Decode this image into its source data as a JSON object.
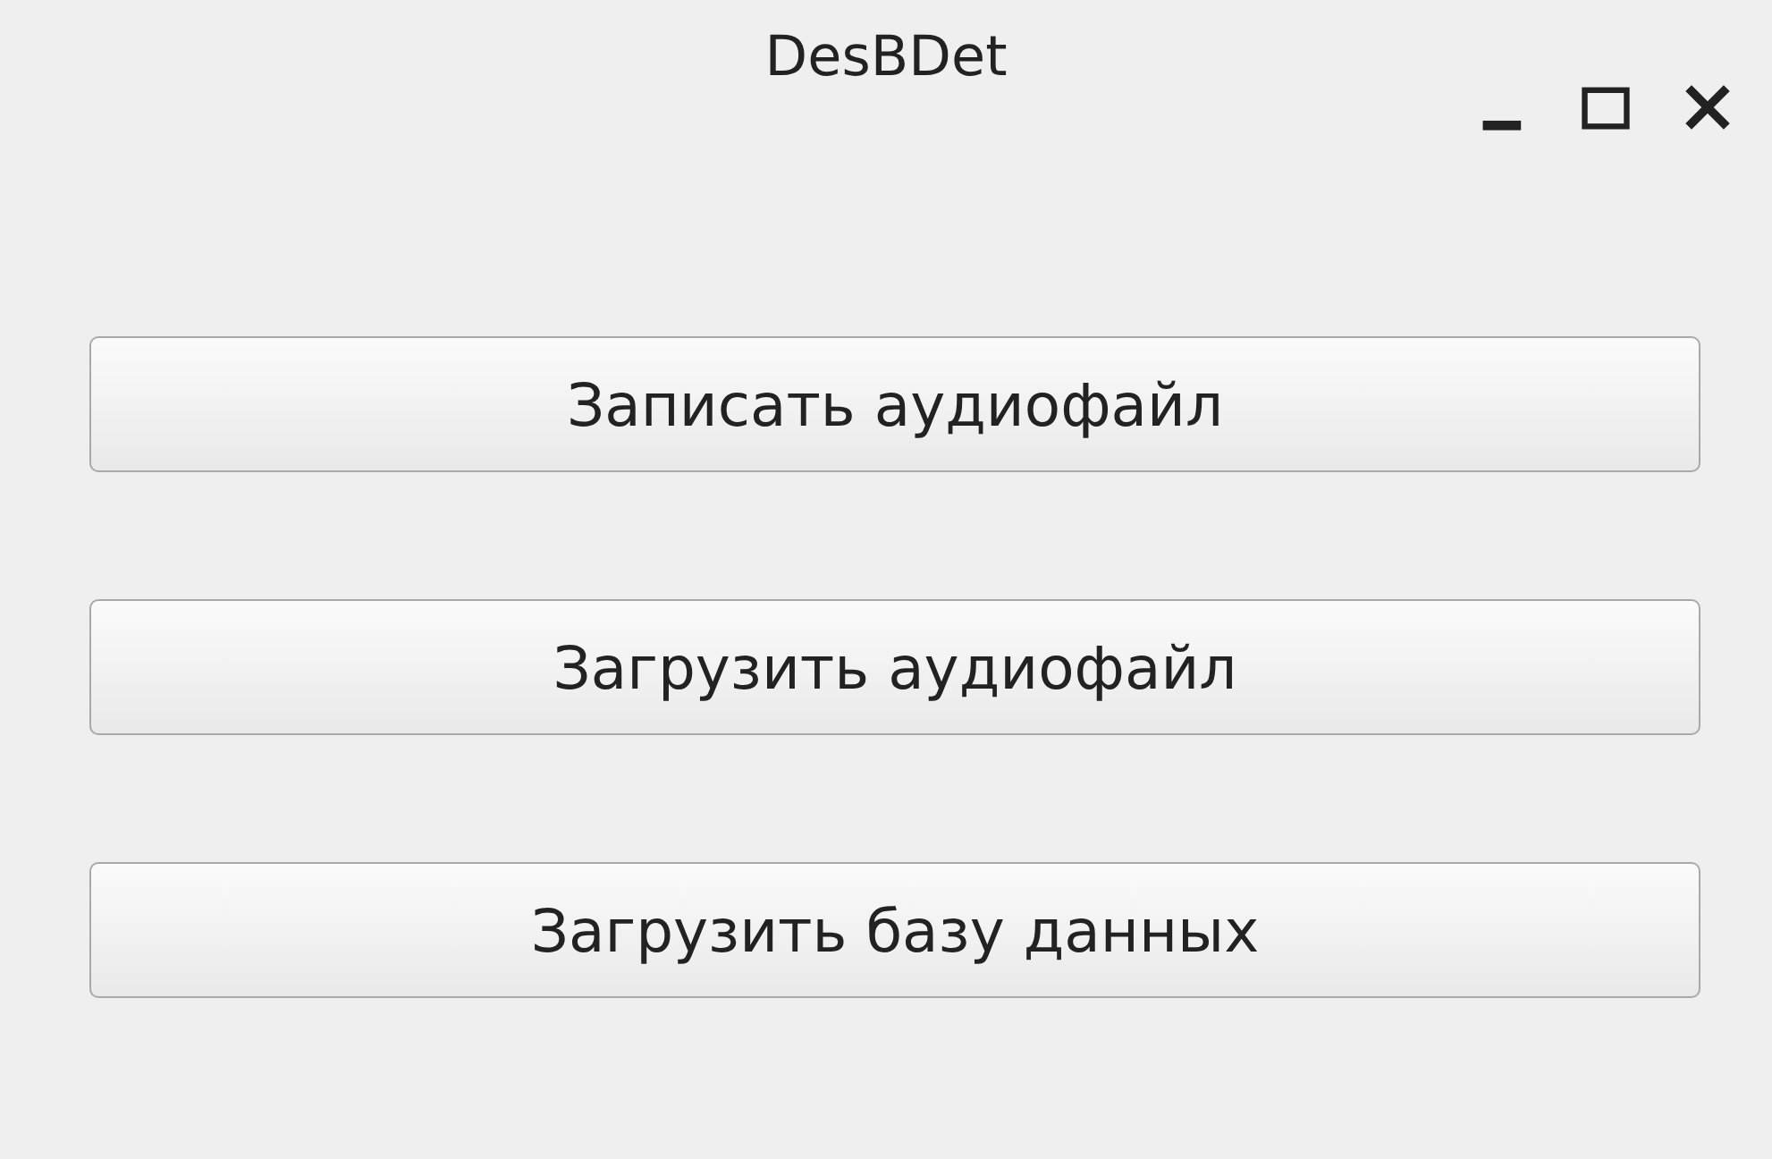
{
  "window": {
    "title": "DesBDet"
  },
  "buttons": [
    {
      "label": "Записать аудиофайл"
    },
    {
      "label": "Загрузить аудиофайл"
    },
    {
      "label": "Загрузить базу данных"
    }
  ]
}
